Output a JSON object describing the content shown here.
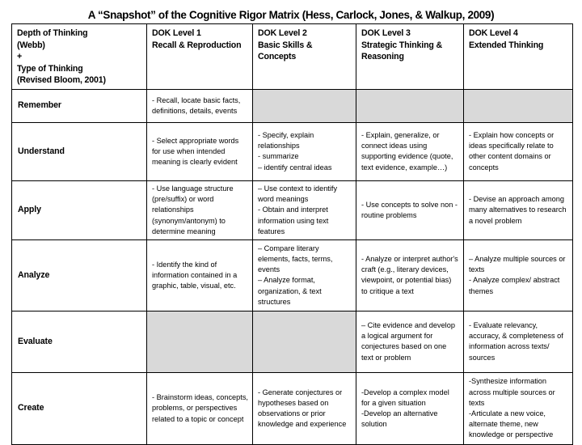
{
  "title": "A “Snapshot” of the Cognitive Rigor Matrix (Hess, Carlock, Jones, & Walkup, 2009)",
  "table": {
    "headers": [
      "Depth of Thinking\n(Webb)\n+\nType of Thinking\n(Revised Bloom, 2001)",
      "DOK Level 1\nRecall & Reproduction",
      "DOK Level 2\nBasic Skills &\nConcepts",
      "DOK Level 3\nStrategic Thinking &\nReasoning",
      "DOK Level 4\nExtended Thinking"
    ],
    "shaded_color": "#d9d9d9",
    "rows": [
      {
        "label": "Remember",
        "cells": [
          {
            "text": "- Recall, locate basic facts, definitions, details, events",
            "shaded": false
          },
          {
            "text": "",
            "shaded": true
          },
          {
            "text": "",
            "shaded": true
          },
          {
            "text": "",
            "shaded": true
          }
        ]
      },
      {
        "label": "Understand",
        "cells": [
          {
            "text": "- Select appropriate words for use when intended meaning is clearly evident",
            "shaded": false
          },
          {
            "text": "- Specify, explain relationships\n- summarize\n– identify central ideas",
            "shaded": false
          },
          {
            "text": "- Explain, generalize, or connect ideas using supporting evidence (quote, text evidence, example…)",
            "shaded": false
          },
          {
            "text": "- Explain how concepts or ideas specifically relate to other content domains or concepts",
            "shaded": false
          }
        ]
      },
      {
        "label": "Apply",
        "cells": [
          {
            "text": "- Use language structure (pre/suffix) or word relationships (synonym/antonym) to determine meaning",
            "shaded": false
          },
          {
            "text": "– Use context to identify word meanings\n- Obtain and interpret information using text features",
            "shaded": false
          },
          {
            "text": "- Use concepts to solve non -routine problems",
            "shaded": false
          },
          {
            "text": "- Devise an approach among many alternatives to research a novel problem",
            "shaded": false
          }
        ]
      },
      {
        "label": "Analyze",
        "cells": [
          {
            "text": "- Identify the kind of information contained in a graphic, table, visual, etc.",
            "shaded": false
          },
          {
            "text": "– Compare literary elements, facts, terms, events\n– Analyze format, organization, & text structures",
            "shaded": false
          },
          {
            "text": "- Analyze or interpret author's craft (e.g., literary devices, viewpoint, or potential bias) to critique a text",
            "shaded": false
          },
          {
            "text": "– Analyze multiple sources or texts\n- Analyze complex/ abstract themes",
            "shaded": false
          }
        ]
      },
      {
        "label": "Evaluate",
        "cells": [
          {
            "text": "",
            "shaded": true
          },
          {
            "text": "",
            "shaded": true
          },
          {
            "text": "– Cite evidence and develop a logical argument for conjectures based on one text or problem",
            "shaded": false
          },
          {
            "text": "- Evaluate relevancy, accuracy, & completeness of information across texts/ sources",
            "shaded": false
          }
        ]
      },
      {
        "label": "Create",
        "cells": [
          {
            "text": "- Brainstorm ideas, concepts, problems, or perspectives related to a topic or concept",
            "shaded": false
          },
          {
            "text": "- Generate conjectures or hypotheses based on observations or prior knowledge and experience",
            "shaded": false
          },
          {
            "text": "-Develop a complex model for a given situation\n-Develop an alternative solution",
            "shaded": false
          },
          {
            "text": "-Synthesize information across multiple sources or texts\n-Articulate a new voice, alternate theme, new knowledge or perspective",
            "shaded": false
          }
        ]
      }
    ]
  }
}
